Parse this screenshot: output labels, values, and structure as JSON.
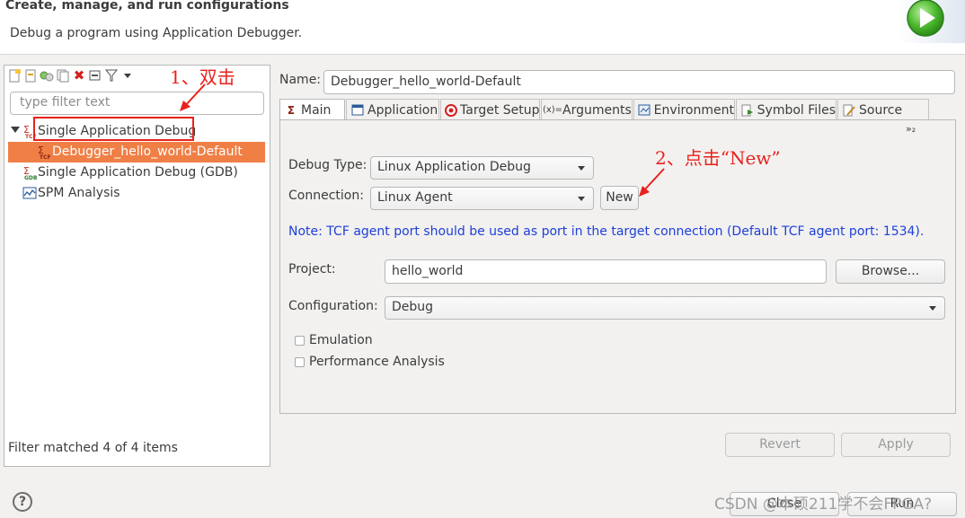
{
  "header": {
    "title": "Create, manage, and run configurations",
    "subtitle": "Debug a program using Application Debugger."
  },
  "left": {
    "filter_placeholder": "type filter text",
    "tree": [
      {
        "label": "Single Application Debug",
        "expanded": true,
        "icon": "tcf-debug-icon"
      },
      {
        "label": "Debugger_hello_world-Default",
        "selected": true,
        "icon": "tcf-config-icon"
      },
      {
        "label": "Single Application Debug (GDB)",
        "icon": "gdb-debug-icon"
      },
      {
        "label": "SPM Analysis",
        "icon": "spm-analysis-icon"
      }
    ],
    "status": "Filter matched 4 of 4 items"
  },
  "annotations": {
    "step1": "1、双击",
    "step2": "2、点击“New”"
  },
  "config": {
    "name_label": "Name:",
    "name_value": "Debugger_hello_world-Default",
    "tabs": [
      {
        "label": "Main",
        "active": true,
        "icon": "main-sigma-icon"
      },
      {
        "label": "Application",
        "icon": "application-icon"
      },
      {
        "label": "Target Setup",
        "icon": "target-setup-icon"
      },
      {
        "label": "Arguments",
        "icon": "arguments-icon"
      },
      {
        "label": "Environment",
        "icon": "environment-icon"
      },
      {
        "label": "Symbol Files",
        "icon": "symbol-files-icon"
      },
      {
        "label": "Source",
        "icon": "source-icon"
      }
    ],
    "tab_overflow": "»₂",
    "debug_type_label": "Debug Type:",
    "debug_type_value": "Linux Application Debug",
    "connection_label": "Connection:",
    "connection_value": "Linux Agent",
    "new_button": "New",
    "note": "Note: TCF agent port should be used as port in the target connection (Default TCF agent port: 1534).",
    "project_label": "Project:",
    "project_value": "hello_world",
    "browse_button": "Browse...",
    "configuration_label": "Configuration:",
    "configuration_value": "Debug",
    "emulation_label": "Emulation",
    "emulation_checked": false,
    "performance_label": "Performance Analysis",
    "performance_checked": false,
    "revert_button": "Revert",
    "apply_button": "Apply"
  },
  "footer": {
    "close_button": "Close",
    "run_button": "Run",
    "watermark": "CSDN @本硕211学不会FPGA?"
  },
  "colors": {
    "selection": "#f07f46",
    "annotation": "#e8211c",
    "note": "#1e3fd6"
  }
}
